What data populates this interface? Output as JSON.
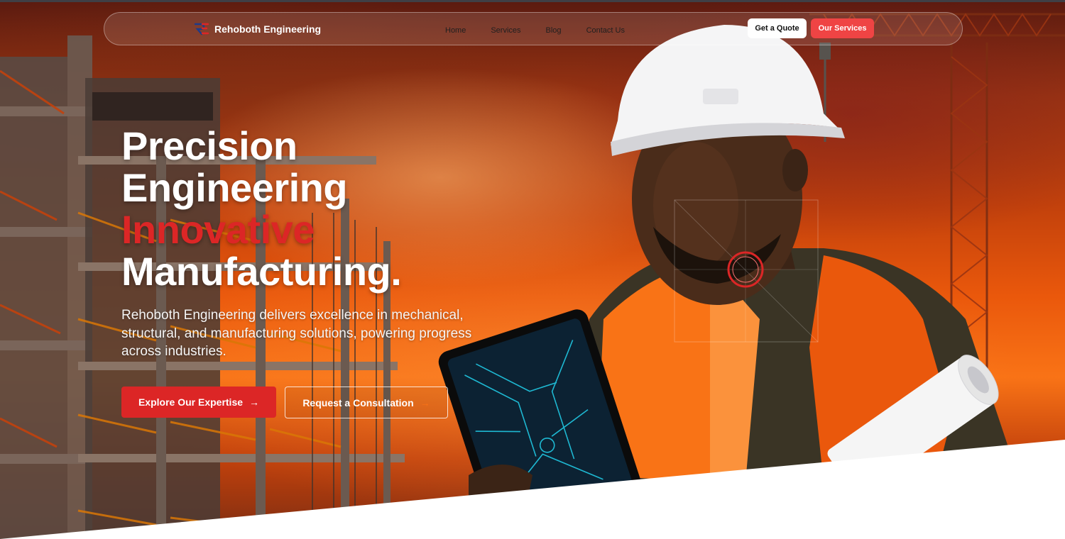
{
  "brand": {
    "name": "Rehoboth Engineering",
    "logo_icon": "re-logo-icon",
    "accent": "#dc2626"
  },
  "nav": {
    "links": [
      "Home",
      "Services",
      "Blog",
      "Contact Us"
    ],
    "quote_label": "Get a Quote",
    "services_label": "Our Services"
  },
  "hero": {
    "line1": "Precision",
    "line2": "Engineering",
    "line3": "Innovative",
    "line4": "Manufacturing.",
    "subtitle": "Rehoboth Engineering delivers excellence in mechanical, structural, and manufacturing solutions, powering progress across industries.",
    "primary_cta": "Explore Our Expertise",
    "secondary_cta": "Request a Consultation",
    "arrow_icon": "arrow-right-icon"
  },
  "colors": {
    "primary": "#dc2626",
    "button_red": "#ef4444",
    "vest": "#f97316"
  }
}
